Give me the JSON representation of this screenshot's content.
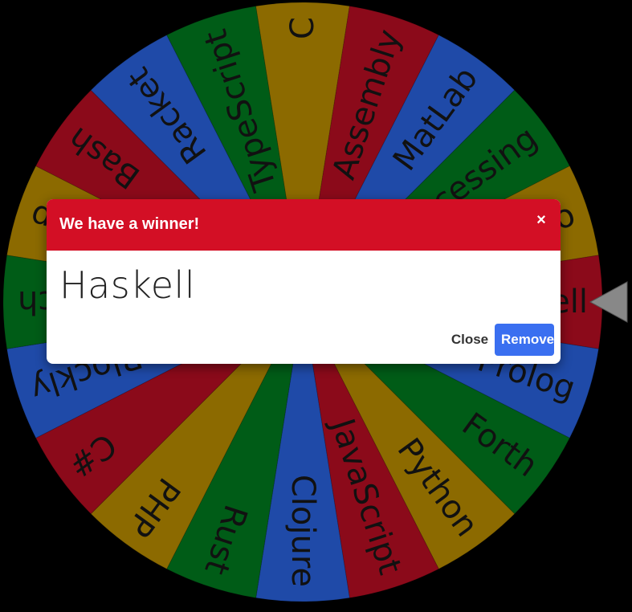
{
  "wheel": {
    "colors": [
      "#8c6a00",
      "#8b0a1a",
      "#1f4aa8",
      "#005c17"
    ],
    "segments": [
      {
        "label": "Haskell",
        "color": "#8b0a1a"
      },
      {
        "label": "Prolog",
        "color": "#1f4aa8"
      },
      {
        "label": "Forth",
        "color": "#005c17"
      },
      {
        "label": "Python",
        "color": "#8c6a00"
      },
      {
        "label": "JavaScript",
        "color": "#8b0a1a"
      },
      {
        "label": "Clojure",
        "color": "#1f4aa8"
      },
      {
        "label": "Rust",
        "color": "#005c17"
      },
      {
        "label": "PHP",
        "color": "#8c6a00"
      },
      {
        "label": "C#",
        "color": "#8b0a1a"
      },
      {
        "label": "Blockly",
        "color": "#1f4aa8"
      },
      {
        "label": "Scratch",
        "color": "#005c17"
      },
      {
        "label": "Lisp",
        "color": "#8c6a00"
      },
      {
        "label": "Bash",
        "color": "#8b0a1a"
      },
      {
        "label": "Racket",
        "color": "#1f4aa8"
      },
      {
        "label": "TypeScript",
        "color": "#005c17"
      },
      {
        "label": "C",
        "color": "#8c6a00"
      },
      {
        "label": "Assembly",
        "color": "#8b0a1a"
      },
      {
        "label": "MatLab",
        "color": "#1f4aa8"
      },
      {
        "label": "Processing",
        "color": "#005c17"
      },
      {
        "label": "Go",
        "color": "#8c6a00"
      }
    ],
    "pointer_color": "#888888"
  },
  "modal": {
    "title": "We have a winner!",
    "close_icon": "×",
    "winner": "Haskell",
    "close_label": "Close",
    "remove_label": "Remove"
  }
}
